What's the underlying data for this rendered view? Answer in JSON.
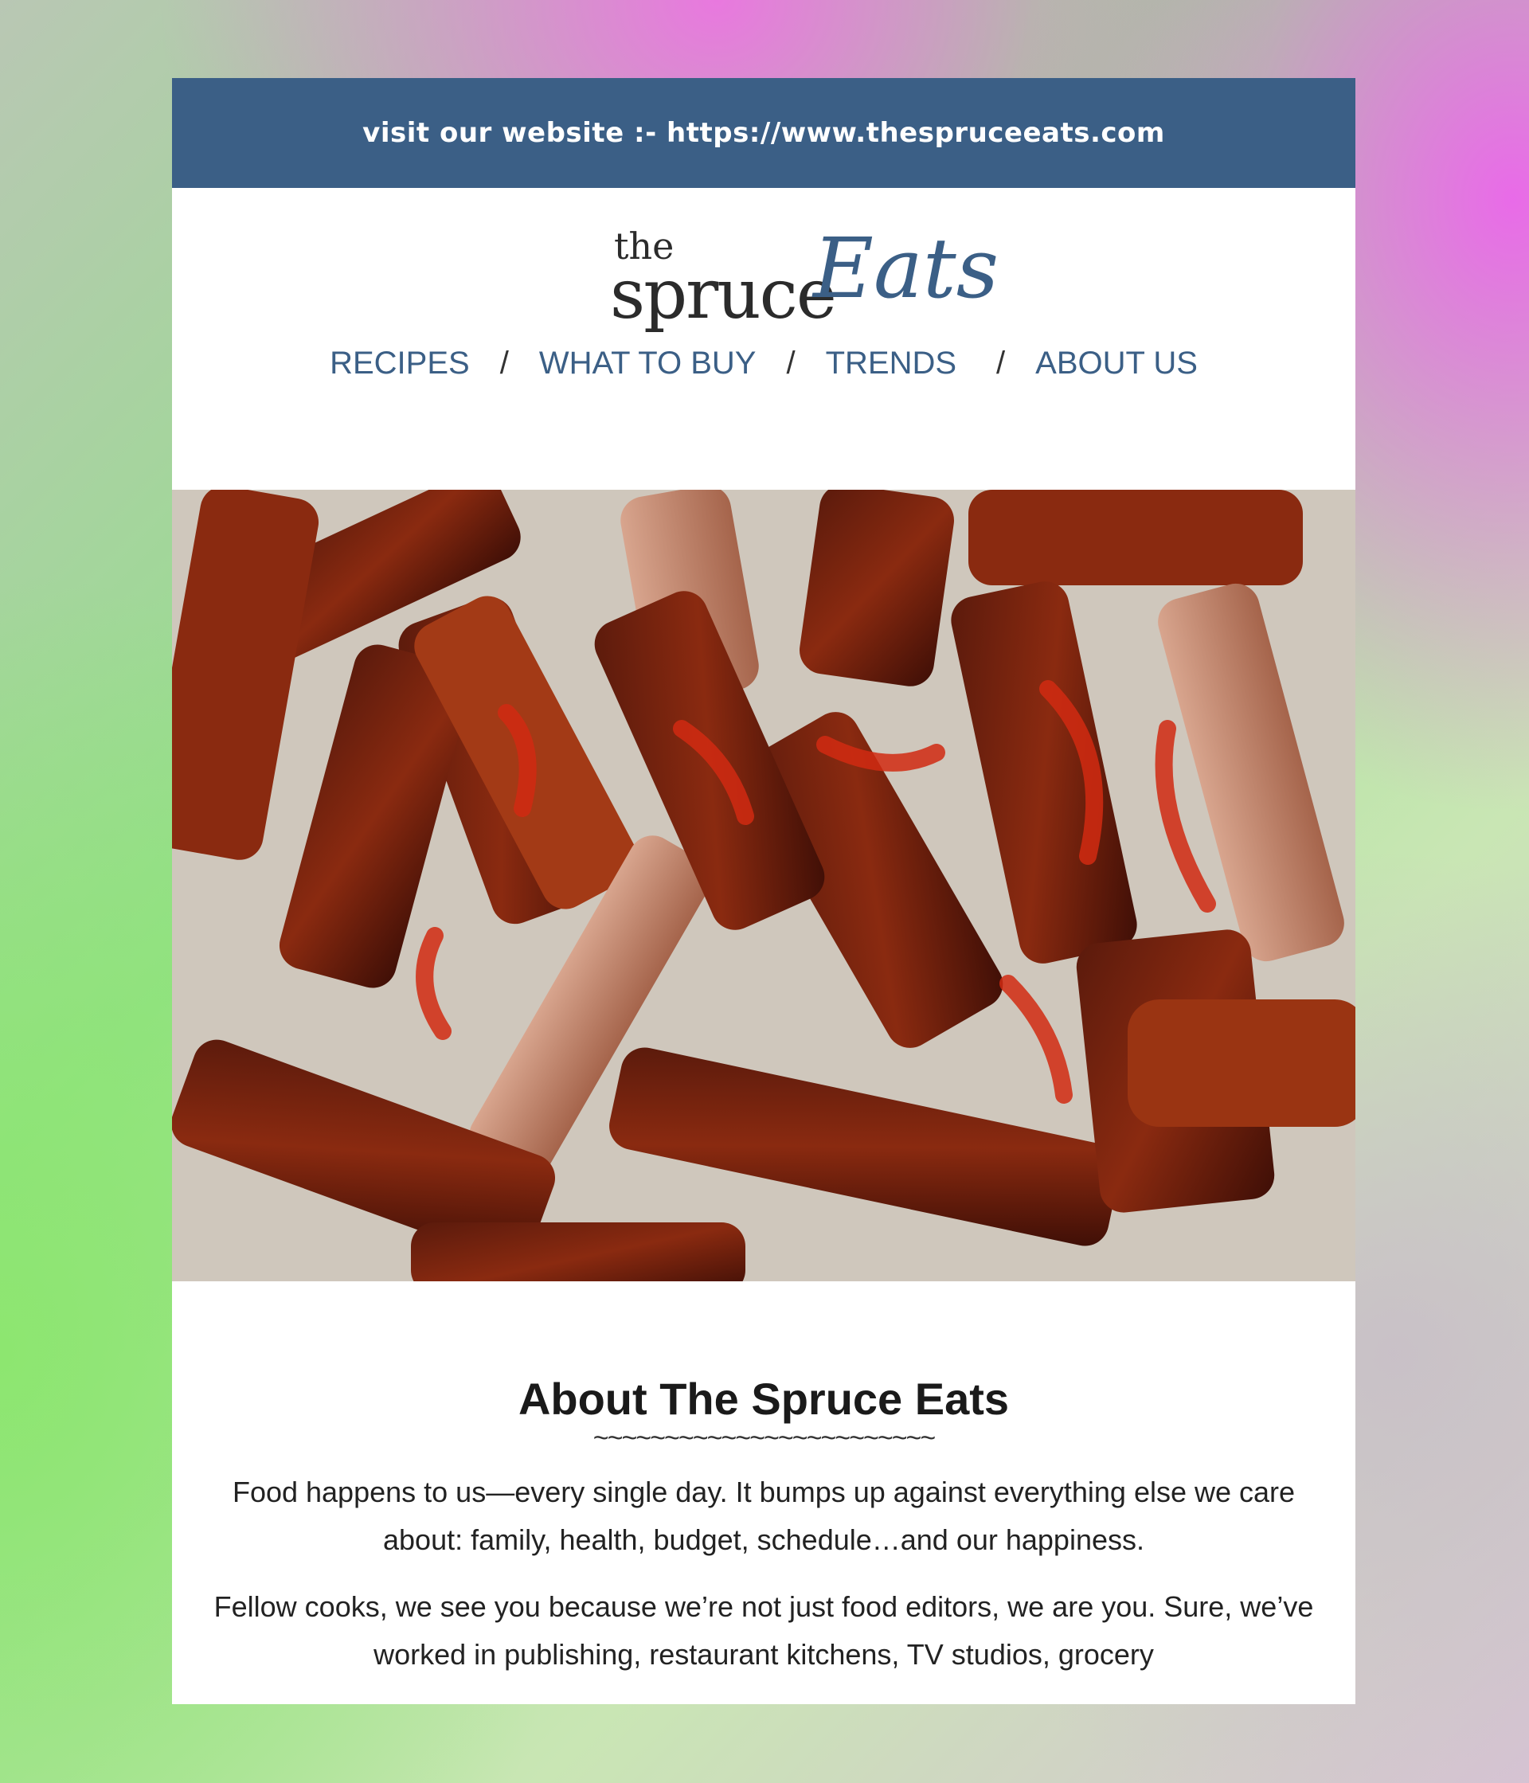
{
  "topbar": {
    "text": "visit our website :- https://www.thespruceeats.com"
  },
  "logo": {
    "the": "the",
    "spruce": "spruce",
    "eats": "Eats"
  },
  "nav": {
    "items": [
      {
        "label": "RECIPES"
      },
      {
        "label": "WHAT TO BUY"
      },
      {
        "label": "TRENDS"
      },
      {
        "label": "ABOUT US"
      }
    ],
    "separator": "/"
  },
  "hero": {
    "icon": "bbq-ribs-photo"
  },
  "about": {
    "title": "About The Spruce Eats",
    "divider": "~~~~~~~~~~~~~~~~~~~~~~~~",
    "paragraph1": "Food happens to us—every single day. It bumps up against everything else we care about: family, health, budget, schedule…and our happiness.",
    "paragraph2": "Fellow cooks, we see you because we’re not just food editors, we are you. Sure, we’ve worked in publishing, restaurant kitchens, TV studios, grocery"
  },
  "colors": {
    "brand": "#3b5f86",
    "text": "#222222"
  }
}
